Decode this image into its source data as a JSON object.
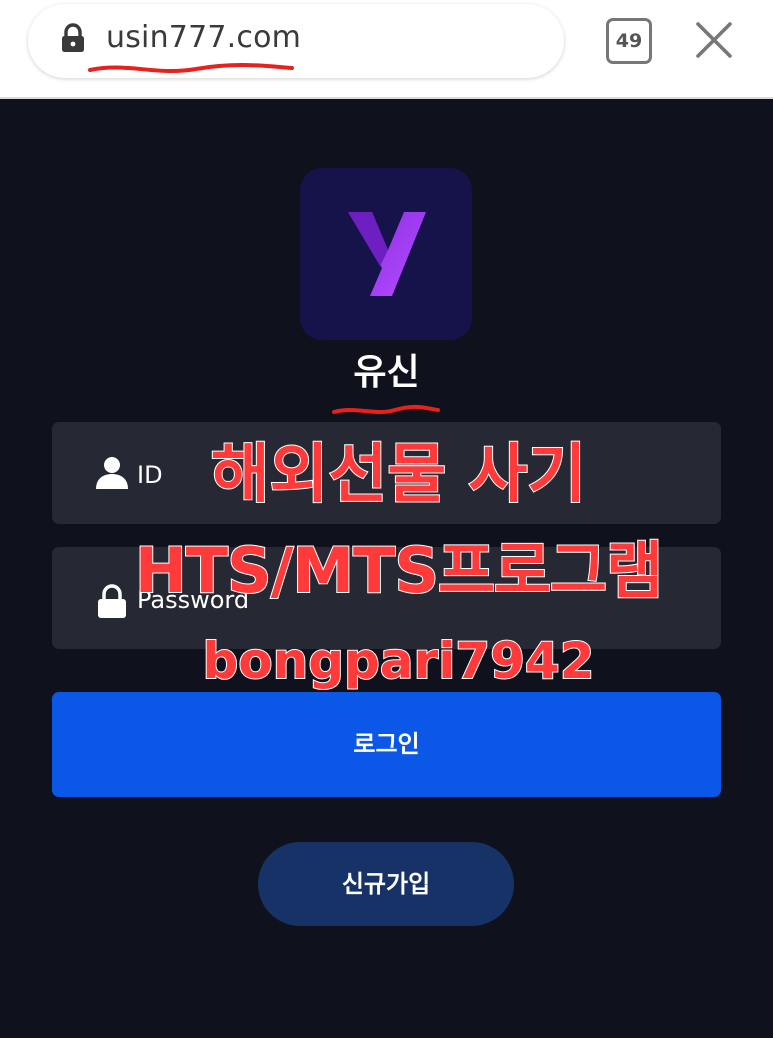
{
  "browser": {
    "url": "usin777.com",
    "tab_count": "49",
    "icons": {
      "lock": "lock-icon",
      "close": "close-icon"
    }
  },
  "app": {
    "name": "유신",
    "logo_icon": "y-logo-icon"
  },
  "login_form": {
    "id_label": "ID",
    "password_label": "Password",
    "login_button": "로그인",
    "signup_button": "신규가입",
    "icons": {
      "id": "user-icon",
      "password": "lock-icon"
    }
  },
  "overlay_text": {
    "line1": "해외선물 사기",
    "line2": "HTS/MTS프로그램",
    "line3": "bongpari7942"
  },
  "colors": {
    "background": "#0f111c",
    "field": "#262834",
    "login_button": "#0a57e8",
    "signup_button": "#173266",
    "overlay_red": "#ff3a3a",
    "logo_bg": "#16134a",
    "logo_y": "#9b3cf0"
  }
}
